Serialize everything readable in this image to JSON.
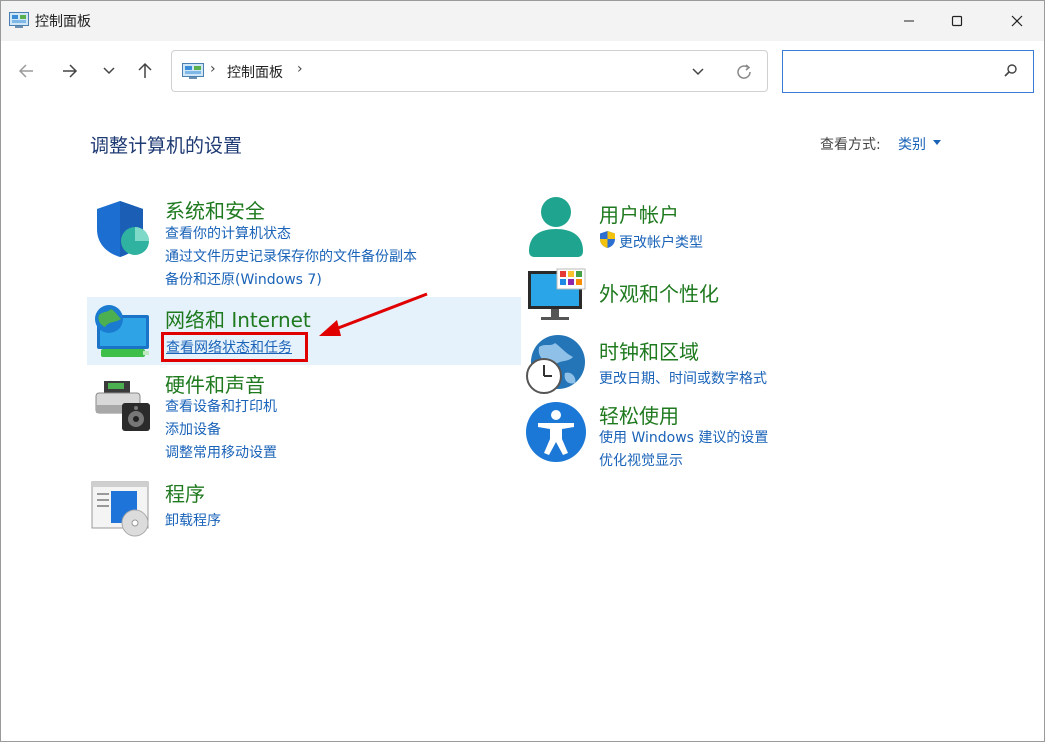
{
  "window": {
    "title": "控制面板"
  },
  "address": {
    "crumb": "控制面板"
  },
  "search": {
    "placeholder": "",
    "value": ""
  },
  "page": {
    "heading": "调整计算机的设置",
    "view_by_label": "查看方式:",
    "view_by_value": "类别"
  },
  "categories": {
    "system": {
      "title": "系统和安全",
      "links": [
        "查看你的计算机状态",
        "通过文件历史记录保存你的文件备份副本",
        "备份和还原(Windows 7)"
      ]
    },
    "network": {
      "title": "网络和 Internet",
      "links": [
        "查看网络状态和任务"
      ]
    },
    "hardware": {
      "title": "硬件和声音",
      "links": [
        "查看设备和打印机",
        "添加设备",
        "调整常用移动设置"
      ]
    },
    "programs": {
      "title": "程序",
      "links": [
        "卸载程序"
      ]
    },
    "users": {
      "title": "用户帐户",
      "links": [
        "更改帐户类型"
      ]
    },
    "appearance": {
      "title": "外观和个性化",
      "links": []
    },
    "clock": {
      "title": "时钟和区域",
      "links": [
        "更改日期、时间或数字格式"
      ]
    },
    "ease": {
      "title": "轻松使用",
      "links": [
        "使用 Windows 建议的设置",
        "优化视觉显示"
      ]
    }
  },
  "colors": {
    "accent": "#1a63b8",
    "category_title": "#1f7a1f",
    "highlight": "#e5f1fb",
    "annotation": "#e00000"
  }
}
